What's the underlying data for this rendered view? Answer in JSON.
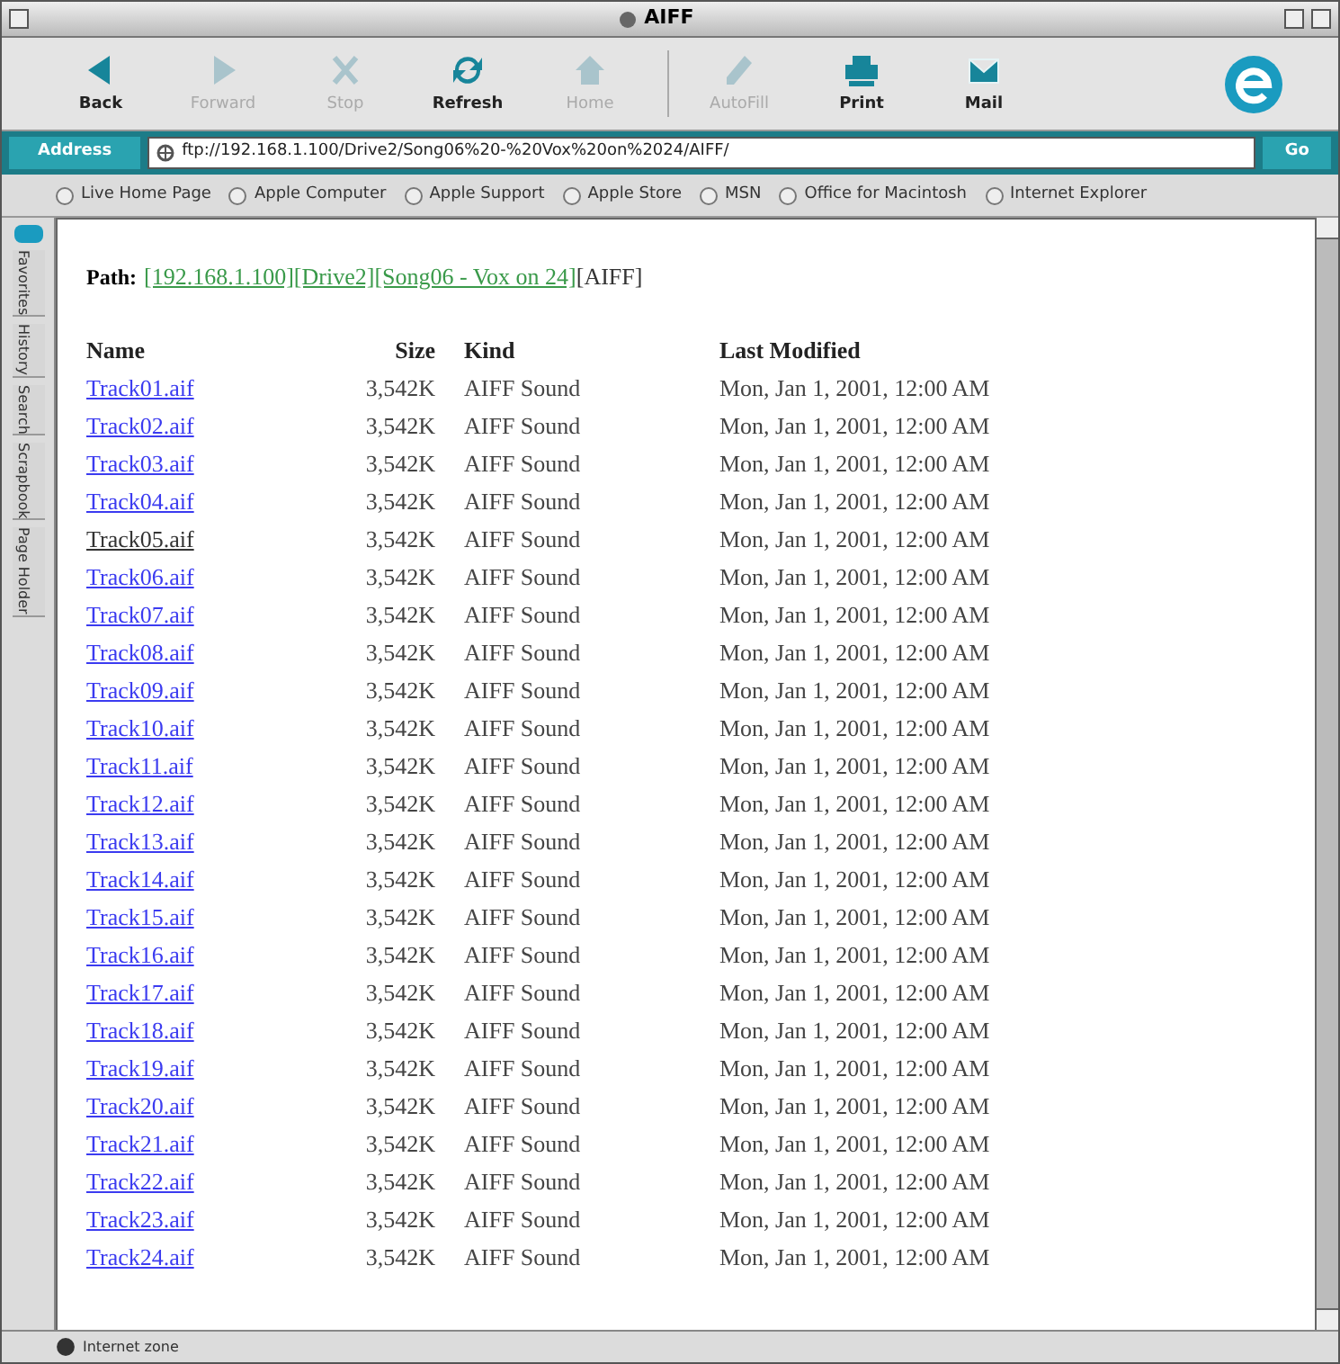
{
  "window": {
    "title": "AIFF"
  },
  "toolbar": [
    {
      "label": "Back",
      "disabled": false
    },
    {
      "label": "Forward",
      "disabled": true
    },
    {
      "label": "Stop",
      "disabled": true
    },
    {
      "label": "Refresh",
      "disabled": false
    },
    {
      "label": "Home",
      "disabled": true
    },
    {
      "label": "AutoFill",
      "disabled": true
    },
    {
      "label": "Print",
      "disabled": false
    },
    {
      "label": "Mail",
      "disabled": false
    }
  ],
  "address_bar": {
    "label": "Address",
    "value": "ftp://192.168.1.100/Drive2/Song06%20-%20Vox%20on%2024/AIFF/",
    "go": "Go"
  },
  "favorites": [
    "Live Home Page",
    "Apple Computer",
    "Apple Support",
    "Apple Store",
    "MSN",
    "Office for Macintosh",
    "Internet Explorer"
  ],
  "sidebar_tabs": [
    {
      "label": "Favorites",
      "selected": false
    },
    {
      "label": "History",
      "selected": false
    },
    {
      "label": "Search",
      "selected": false
    },
    {
      "label": "Scrapbook",
      "selected": false
    },
    {
      "label": "Page Holder",
      "selected": false
    }
  ],
  "path": {
    "label": "Path:",
    "segments": [
      {
        "text": "[192.168.1.100]",
        "kind": "link"
      },
      {
        "text": "[Drive2]",
        "kind": "link"
      },
      {
        "text": "[Song06 - Vox on 24]",
        "kind": "link"
      },
      {
        "text": "[AIFF]",
        "kind": "plain"
      }
    ]
  },
  "table": {
    "columns": [
      "Name",
      "Size",
      "Kind",
      "Last Modified"
    ],
    "rows": [
      {
        "name": "Track01.aif",
        "size": "3,542K",
        "kind": "AIFF Sound",
        "modified": "Mon, Jan 1, 2001, 12:00 AM",
        "visited": false
      },
      {
        "name": "Track02.aif",
        "size": "3,542K",
        "kind": "AIFF Sound",
        "modified": "Mon, Jan 1, 2001, 12:00 AM",
        "visited": false
      },
      {
        "name": "Track03.aif",
        "size": "3,542K",
        "kind": "AIFF Sound",
        "modified": "Mon, Jan 1, 2001, 12:00 AM",
        "visited": false
      },
      {
        "name": "Track04.aif",
        "size": "3,542K",
        "kind": "AIFF Sound",
        "modified": "Mon, Jan 1, 2001, 12:00 AM",
        "visited": false
      },
      {
        "name": "Track05.aif",
        "size": "3,542K",
        "kind": "AIFF Sound",
        "modified": "Mon, Jan 1, 2001, 12:00 AM",
        "visited": true
      },
      {
        "name": "Track06.aif",
        "size": "3,542K",
        "kind": "AIFF Sound",
        "modified": "Mon, Jan 1, 2001, 12:00 AM",
        "visited": false
      },
      {
        "name": "Track07.aif",
        "size": "3,542K",
        "kind": "AIFF Sound",
        "modified": "Mon, Jan 1, 2001, 12:00 AM",
        "visited": false
      },
      {
        "name": "Track08.aif",
        "size": "3,542K",
        "kind": "AIFF Sound",
        "modified": "Mon, Jan 1, 2001, 12:00 AM",
        "visited": false
      },
      {
        "name": "Track09.aif",
        "size": "3,542K",
        "kind": "AIFF Sound",
        "modified": "Mon, Jan 1, 2001, 12:00 AM",
        "visited": false
      },
      {
        "name": "Track10.aif",
        "size": "3,542K",
        "kind": "AIFF Sound",
        "modified": "Mon, Jan 1, 2001, 12:00 AM",
        "visited": false
      },
      {
        "name": "Track11.aif",
        "size": "3,542K",
        "kind": "AIFF Sound",
        "modified": "Mon, Jan 1, 2001, 12:00 AM",
        "visited": false
      },
      {
        "name": "Track12.aif",
        "size": "3,542K",
        "kind": "AIFF Sound",
        "modified": "Mon, Jan 1, 2001, 12:00 AM",
        "visited": false
      },
      {
        "name": "Track13.aif",
        "size": "3,542K",
        "kind": "AIFF Sound",
        "modified": "Mon, Jan 1, 2001, 12:00 AM",
        "visited": false
      },
      {
        "name": "Track14.aif",
        "size": "3,542K",
        "kind": "AIFF Sound",
        "modified": "Mon, Jan 1, 2001, 12:00 AM",
        "visited": false
      },
      {
        "name": "Track15.aif",
        "size": "3,542K",
        "kind": "AIFF Sound",
        "modified": "Mon, Jan 1, 2001, 12:00 AM",
        "visited": false
      },
      {
        "name": "Track16.aif",
        "size": "3,542K",
        "kind": "AIFF Sound",
        "modified": "Mon, Jan 1, 2001, 12:00 AM",
        "visited": false
      },
      {
        "name": "Track17.aif",
        "size": "3,542K",
        "kind": "AIFF Sound",
        "modified": "Mon, Jan 1, 2001, 12:00 AM",
        "visited": false
      },
      {
        "name": "Track18.aif",
        "size": "3,542K",
        "kind": "AIFF Sound",
        "modified": "Mon, Jan 1, 2001, 12:00 AM",
        "visited": false
      },
      {
        "name": "Track19.aif",
        "size": "3,542K",
        "kind": "AIFF Sound",
        "modified": "Mon, Jan 1, 2001, 12:00 AM",
        "visited": false
      },
      {
        "name": "Track20.aif",
        "size": "3,542K",
        "kind": "AIFF Sound",
        "modified": "Mon, Jan 1, 2001, 12:00 AM",
        "visited": false
      },
      {
        "name": "Track21.aif",
        "size": "3,542K",
        "kind": "AIFF Sound",
        "modified": "Mon, Jan 1, 2001, 12:00 AM",
        "visited": false
      },
      {
        "name": "Track22.aif",
        "size": "3,542K",
        "kind": "AIFF Sound",
        "modified": "Mon, Jan 1, 2001, 12:00 AM",
        "visited": false
      },
      {
        "name": "Track23.aif",
        "size": "3,542K",
        "kind": "AIFF Sound",
        "modified": "Mon, Jan 1, 2001, 12:00 AM",
        "visited": false
      },
      {
        "name": "Track24.aif",
        "size": "3,542K",
        "kind": "AIFF Sound",
        "modified": "Mon, Jan 1, 2001, 12:00 AM",
        "visited": false
      }
    ]
  },
  "status_bar": {
    "text": "Internet zone"
  }
}
